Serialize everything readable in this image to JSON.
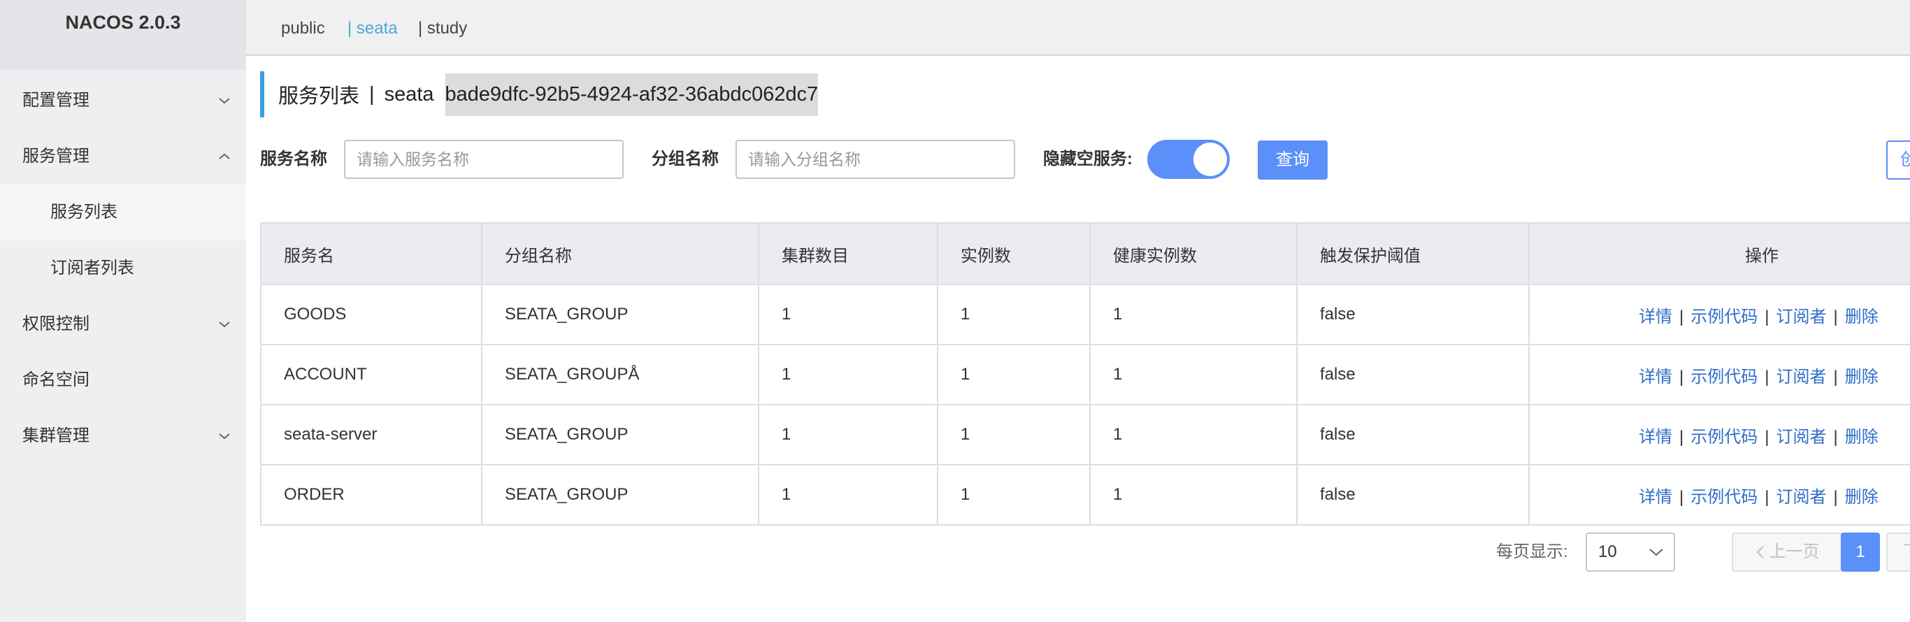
{
  "app": {
    "title": "NACOS 2.0.3"
  },
  "sidebar": {
    "items": [
      {
        "label": "配置管理",
        "icon": "chevron-down-icon"
      },
      {
        "label": "服务管理",
        "icon": "chevron-up-icon"
      },
      {
        "label": "服务列表"
      },
      {
        "label": "订阅者列表"
      },
      {
        "label": "权限控制",
        "icon": "chevron-down-icon"
      },
      {
        "label": "命名空间"
      },
      {
        "label": "集群管理",
        "icon": "chevron-down-icon"
      }
    ]
  },
  "namespaces": {
    "public": "public",
    "seata": "| seata",
    "study": "| study"
  },
  "title": {
    "page": "服务列表",
    "sep": "|",
    "namespace_name": "seata",
    "namespace_id": "bade9dfc-92b5-4924-af32-36abdc062dc7"
  },
  "filters": {
    "service_name_label": "服务名称",
    "service_name_placeholder": "请输入服务名称",
    "group_name_label": "分组名称",
    "group_name_placeholder": "请输入分组名称",
    "hide_empty_label": "隐藏空服务:",
    "hide_empty_on": true,
    "query_label": "查询",
    "create_label": "创"
  },
  "table": {
    "columns": [
      "服务名",
      "分组名称",
      "集群数目",
      "实例数",
      "健康实例数",
      "触发保护阈值",
      "操作"
    ],
    "rows": [
      [
        "GOODS",
        "SEATA_GROUP",
        "1",
        "1",
        "1",
        "false"
      ],
      [
        "ACCOUNT",
        "SEATA_GROUPÅ",
        "1",
        "1",
        "1",
        "false"
      ],
      [
        "seata-server",
        "SEATA_GROUP",
        "1",
        "1",
        "1",
        "false"
      ],
      [
        "ORDER",
        "SEATA_GROUP",
        "1",
        "1",
        "1",
        "false"
      ]
    ],
    "actions": {
      "detail": "详情",
      "sample_code": "示例代码",
      "subscribers": "订阅者",
      "delete": "删除",
      "sep": "|"
    }
  },
  "pagination": {
    "page_size_label": "每页显示:",
    "page_size": "10",
    "prev_label": "上一页",
    "current_page": "1",
    "next_label": "下"
  },
  "colors": {
    "accent": "#5b8ff9",
    "link": "#2e6ec9",
    "active_ns": "#4aa8d8"
  }
}
